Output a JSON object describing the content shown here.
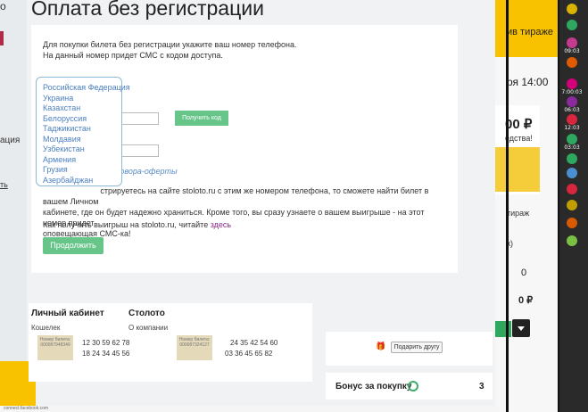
{
  "modal": {
    "title": "Оплата без регистрации",
    "intro_line1": "Для покупки билета без регистрации укажите ваш номер телефона.",
    "intro_line2": "На данный номер придет СМС с кодом доступа.",
    "get_code_label": "Получить код",
    "offer_link": "договора-оферты",
    "body_line1": "стрируетесь на сайте stoloto.ru с этим же номером телефона, то сможете найти билет в вашем Личном",
    "body_line2": "кабинете, где он будет надежно храниться. Кроме того, вы сразу узнаете о вашем выигрыше - на этот номер придет",
    "body_line3": "оповещающая СМС-ка!",
    "how_text": "Как получить выигрыш на stoloto.ru, читайте",
    "how_link": "здесь",
    "continue_label": "Продолжить"
  },
  "countries": [
    "Российская Федерация",
    "Украина",
    "Казахстан",
    "Белоруссия",
    "Таджикистан",
    "Молдавия",
    "Узбекистан",
    "Армения",
    "Грузия",
    "Азербайджан"
  ],
  "background": {
    "tiraj_link": "ив тираже",
    "date": "ря 14:00",
    "prize": "00 ₽",
    "sredstv": "едства!",
    "tiraj2": "тираж",
    "k": "к)",
    "zero1": "0",
    "zero2": "0 ₽",
    "left_cia": "ация",
    "left_ti": "ть",
    "left_o": "о"
  },
  "footer": {
    "cabinet_heading": "Личный кабинет",
    "stoloto_heading": "Столото",
    "wallet_link": "Кошелек",
    "about_link": "О компании",
    "gift_button": "Подарить другу",
    "bonus_label": "Бонус за покупку",
    "bonus_value": "3",
    "ticket1_label": "Номер билета: 000087948349",
    "ticket1_row1": "12      30        59  62  78",
    "ticket1_row2": "18  24  34  45  56",
    "ticket2_label": "Номер билета: 000087324127",
    "ticket2_row1": "24  35  42  54  60",
    "ticket2_row2": "03        36  45        65        82",
    "status_url": "connect.facebook.com"
  },
  "lotto_times": [
    "",
    "",
    "09:03",
    "",
    "7:00:03",
    "06:03",
    "12:03",
    "03:03",
    "",
    "",
    "",
    "",
    "",
    ""
  ],
  "colors": {
    "accent_green": "#67c58a",
    "link_blue": "#4a7fbf",
    "brand_yellow": "#f8c200"
  }
}
